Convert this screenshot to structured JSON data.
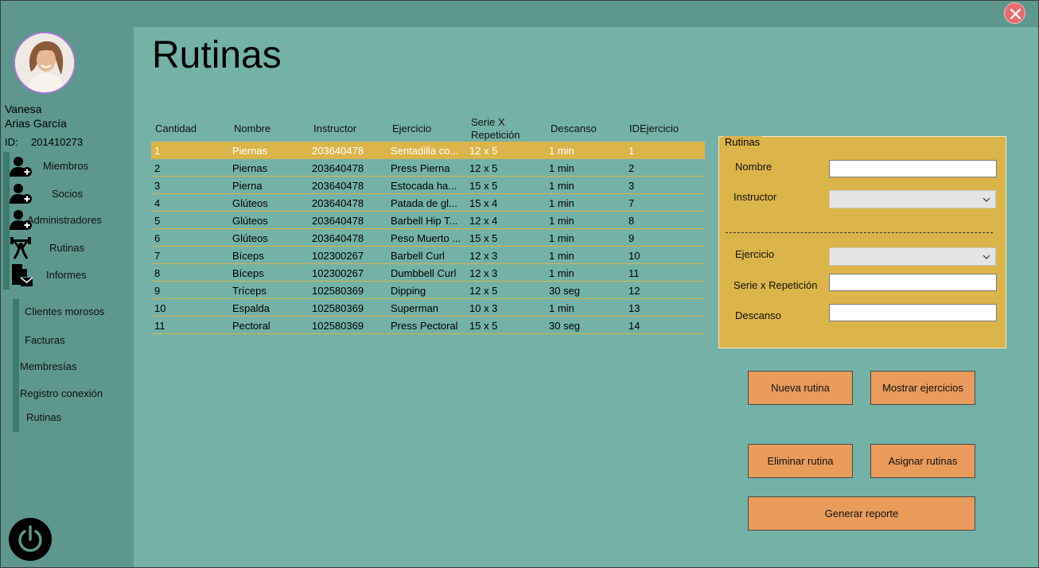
{
  "window": {
    "close_icon": "close-icon"
  },
  "user": {
    "first_name": "Vanesa",
    "last_name": "Arias García",
    "id_label": "ID:",
    "id": "201410273"
  },
  "sidebar": {
    "items": [
      {
        "label": "Miembros",
        "icon": "user-add-icon"
      },
      {
        "label": "Socios",
        "icon": "user-add-icon"
      },
      {
        "label": "Administradores",
        "icon": "user-add-icon"
      },
      {
        "label": "Rutinas",
        "icon": "weightlifter-icon"
      },
      {
        "label": "Informes",
        "icon": "report-mail-icon"
      }
    ],
    "subitems": [
      {
        "label": "Clientes morosos"
      },
      {
        "label": "Facturas"
      },
      {
        "label": "Membresías"
      },
      {
        "label": "Registro conexión"
      },
      {
        "label": "Rutinas"
      }
    ],
    "power_icon": "power-icon"
  },
  "page": {
    "title": "Rutinas"
  },
  "table": {
    "headers": {
      "cantidad": "Cantidad",
      "nombre": "Nombre",
      "instructor": "Instructor",
      "ejercicio": "Ejercicio",
      "serie_line1": "Serie X",
      "serie_line2": "Repetición",
      "descanso": "Descanso",
      "idejercicio": "IDEjercicio"
    },
    "rows": [
      {
        "cantidad": "1",
        "nombre": "Piernas",
        "instructor": "203640478",
        "ejercicio": "Sentadilla co...",
        "serie": "12 x 5",
        "descanso": "1 min",
        "id": "1"
      },
      {
        "cantidad": "2",
        "nombre": "Piernas",
        "instructor": "203640478",
        "ejercicio": "Press Pierna",
        "serie": "12 x 5",
        "descanso": "1 min",
        "id": "2"
      },
      {
        "cantidad": "3",
        "nombre": "Pierna",
        "instructor": "203640478",
        "ejercicio": "Estocada ha...",
        "serie": "15 x 5",
        "descanso": "1 min",
        "id": "3"
      },
      {
        "cantidad": "4",
        "nombre": "Glúteos",
        "instructor": "203640478",
        "ejercicio": "Patada de gl...",
        "serie": "15 x 4",
        "descanso": "1 min",
        "id": "7"
      },
      {
        "cantidad": "5",
        "nombre": "Glúteos",
        "instructor": "203640478",
        "ejercicio": "Barbell Hip T...",
        "serie": "12 x 4",
        "descanso": "1 min",
        "id": "8"
      },
      {
        "cantidad": "6",
        "nombre": "Glúteos",
        "instructor": "203640478",
        "ejercicio": "Peso Muerto ...",
        "serie": "15 x 5",
        "descanso": "1 min",
        "id": "9"
      },
      {
        "cantidad": "7",
        "nombre": "Bíceps",
        "instructor": "102300267",
        "ejercicio": "Barbell Curl",
        "serie": "12 x 3",
        "descanso": "1 min",
        "id": "10"
      },
      {
        "cantidad": "8",
        "nombre": "Bíceps",
        "instructor": "102300267",
        "ejercicio": "Dumbbell Curl",
        "serie": "12 x 3",
        "descanso": "1 min",
        "id": "11"
      },
      {
        "cantidad": "9",
        "nombre": "Tríceps",
        "instructor": "102580369",
        "ejercicio": "Dipping",
        "serie": "12 x 5",
        "descanso": "30 seg",
        "id": "12"
      },
      {
        "cantidad": "10",
        "nombre": "Espalda",
        "instructor": "102580369",
        "ejercicio": "Superman",
        "serie": "10 x 3",
        "descanso": "1 min",
        "id": "13"
      },
      {
        "cantidad": "11",
        "nombre": "Pectoral",
        "instructor": "102580369",
        "ejercicio": "Press Pectoral",
        "serie": "15 x 5",
        "descanso": "30 seg",
        "id": "14"
      }
    ]
  },
  "form": {
    "group_title": "Rutinas",
    "nombre_label": "Nombre",
    "nombre_value": "",
    "instructor_label": "Instructor",
    "instructor_value": "",
    "ejercicio_label": "Ejercicio",
    "ejercicio_value": "",
    "serie_label": "Serie x Repetición",
    "serie_value": "",
    "descanso_label": "Descanso",
    "descanso_value": ""
  },
  "buttons": {
    "nueva": "Nueva rutina",
    "mostrar": "Mostrar ejercicios",
    "eliminar": "Eliminar rutina",
    "asignar": "Asignar rutinas",
    "generar": "Generar reporte"
  },
  "colors": {
    "sidebar_bg": "#5d978d",
    "main_bg": "#74b2a8",
    "accent_gold": "#dbb44a",
    "button_orange": "#e89b5b",
    "close_red": "#e96b6f"
  }
}
